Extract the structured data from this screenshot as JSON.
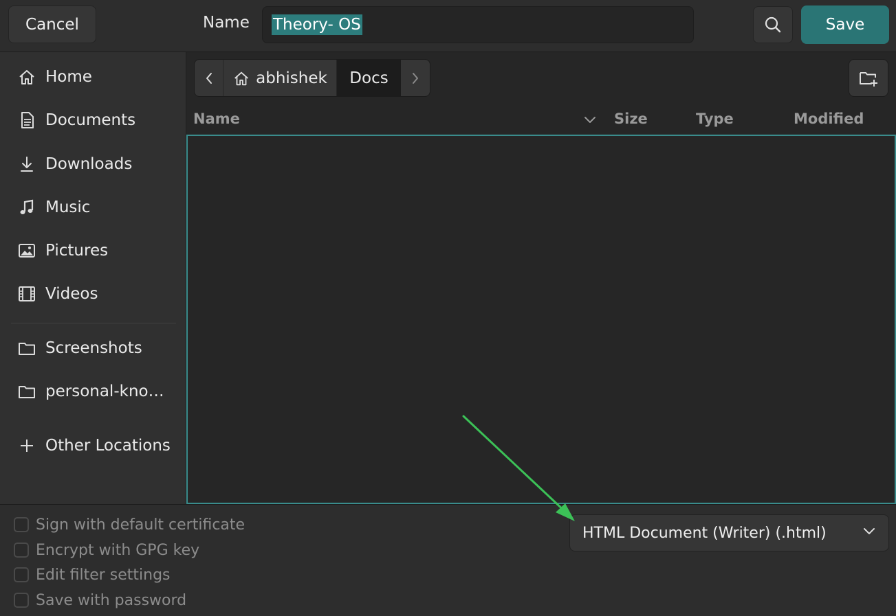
{
  "header": {
    "cancel_label": "Cancel",
    "name_label": "Name",
    "filename_value": "Theory- OS",
    "save_label": "Save"
  },
  "sidebar": {
    "places": [
      {
        "label": "Home",
        "icon": "home-icon"
      },
      {
        "label": "Documents",
        "icon": "document-icon"
      },
      {
        "label": "Downloads",
        "icon": "download-icon"
      },
      {
        "label": "Music",
        "icon": "music-note-icon"
      },
      {
        "label": "Pictures",
        "icon": "picture-icon"
      },
      {
        "label": "Videos",
        "icon": "film-icon"
      }
    ],
    "bookmarks": [
      {
        "label": "Screenshots",
        "icon": "folder-icon"
      },
      {
        "label": "personal-kno…",
        "icon": "folder-icon"
      }
    ],
    "other_locations_label": "Other Locations"
  },
  "pathbar": {
    "segments": [
      "abhishek",
      "Docs"
    ],
    "current": "Docs"
  },
  "file_list": {
    "columns": [
      "Name",
      "Size",
      "Type",
      "Modified"
    ],
    "rows": []
  },
  "footer": {
    "options": [
      {
        "label": "Sign with default certificate",
        "checked": false
      },
      {
        "label": "Encrypt with GPG key",
        "checked": false
      },
      {
        "label": "Edit filter settings",
        "checked": false
      },
      {
        "label": "Save with password",
        "checked": false
      }
    ],
    "file_type": "HTML Document (Writer) (.html)"
  },
  "colors": {
    "accent": "#2a7575",
    "selection": "#2d7d7d",
    "annotation_arrow": "#3cc157"
  }
}
